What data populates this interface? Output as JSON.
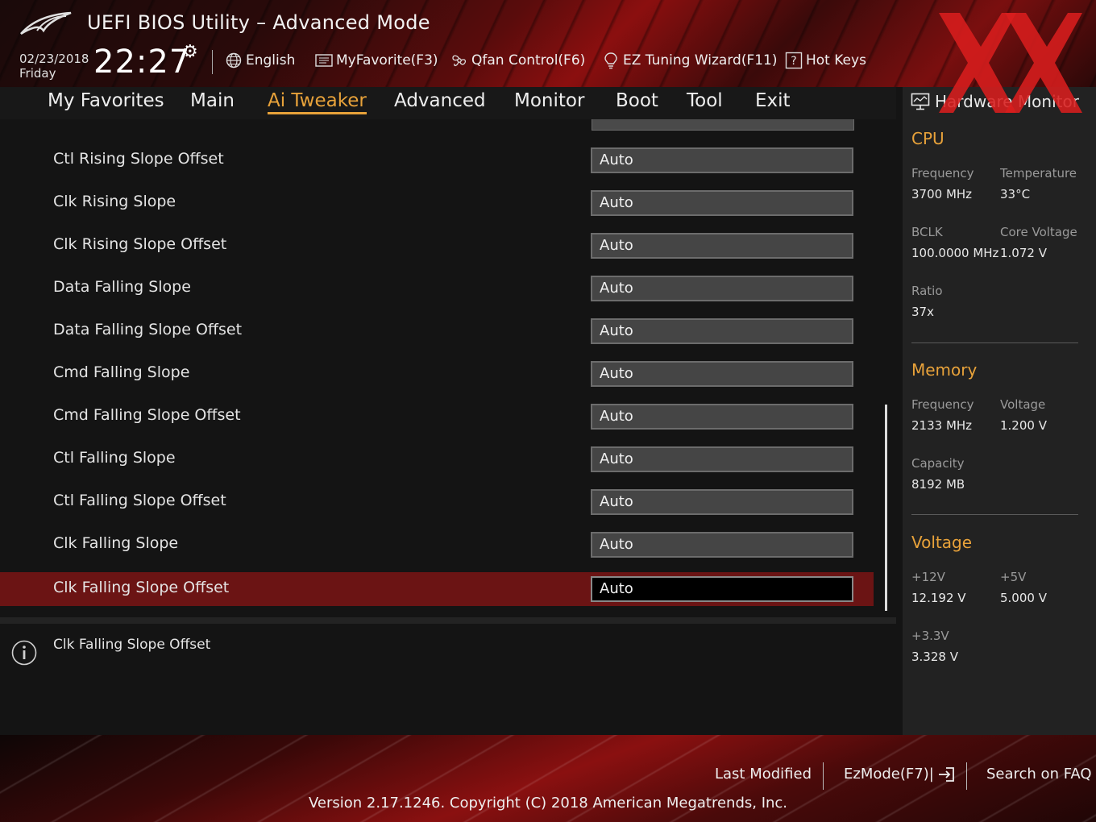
{
  "header": {
    "title": "UEFI BIOS Utility – Advanced Mode",
    "date": "02/23/2018",
    "weekday": "Friday",
    "time": "22:27",
    "toolbar": [
      {
        "label": "English",
        "icon": "globe-icon"
      },
      {
        "label": "MyFavorite(F3)",
        "icon": "favorite-list-icon"
      },
      {
        "label": "Qfan Control(F6)",
        "icon": "fan-icon"
      },
      {
        "label": "EZ Tuning Wizard(F11)",
        "icon": "lightbulb-icon"
      },
      {
        "label": "Hot Keys",
        "icon": "help-box-icon"
      }
    ]
  },
  "nav": {
    "tabs": [
      "My Favorites",
      "Main",
      "Ai Tweaker",
      "Advanced",
      "Monitor",
      "Boot",
      "Tool",
      "Exit"
    ],
    "active": "Ai Tweaker"
  },
  "settings": [
    {
      "label": "Ctl Rising Slope Offset",
      "value": "Auto"
    },
    {
      "label": "Clk Rising Slope",
      "value": "Auto"
    },
    {
      "label": "Clk Rising Slope Offset",
      "value": "Auto"
    },
    {
      "label": "Data Falling Slope",
      "value": "Auto"
    },
    {
      "label": "Data Falling Slope Offset",
      "value": "Auto"
    },
    {
      "label": "Cmd Falling Slope",
      "value": "Auto"
    },
    {
      "label": "Cmd Falling Slope Offset",
      "value": "Auto"
    },
    {
      "label": "Ctl Falling Slope",
      "value": "Auto"
    },
    {
      "label": "Ctl Falling Slope Offset",
      "value": "Auto"
    },
    {
      "label": "Clk Falling Slope",
      "value": "Auto"
    },
    {
      "label": "Clk Falling Slope Offset",
      "value": "Auto"
    }
  ],
  "selected_index": 10,
  "help": {
    "text": "Clk Falling Slope Offset"
  },
  "hw_monitor": {
    "title": "Hardware Monitor",
    "cpu": {
      "heading": "CPU",
      "frequency_label": "Frequency",
      "frequency": "3700 MHz",
      "temperature_label": "Temperature",
      "temperature": "33°C",
      "bclk_label": "BCLK",
      "bclk": "100.0000 MHz",
      "core_voltage_label": "Core Voltage",
      "core_voltage": "1.072 V",
      "ratio_label": "Ratio",
      "ratio": "37x"
    },
    "memory": {
      "heading": "Memory",
      "frequency_label": "Frequency",
      "frequency": "2133 MHz",
      "voltage_label": "Voltage",
      "voltage": "1.200 V",
      "capacity_label": "Capacity",
      "capacity": "8192 MB"
    },
    "voltage": {
      "heading": "Voltage",
      "v12_label": "+12V",
      "v12": "12.192 V",
      "v5_label": "+5V",
      "v5": "5.000 V",
      "v33_label": "+3.3V",
      "v33": "3.328 V"
    }
  },
  "footer": {
    "last_modified": "Last Modified",
    "ezmode": "EzMode(F7)|",
    "search_faq": "Search on FAQ",
    "version": "Version 2.17.1246. Copyright (C) 2018 American Megatrends, Inc."
  },
  "colors": {
    "accent": "#e8a23a",
    "selected_row": "#6b1414",
    "watermark": "#d81e1e"
  }
}
